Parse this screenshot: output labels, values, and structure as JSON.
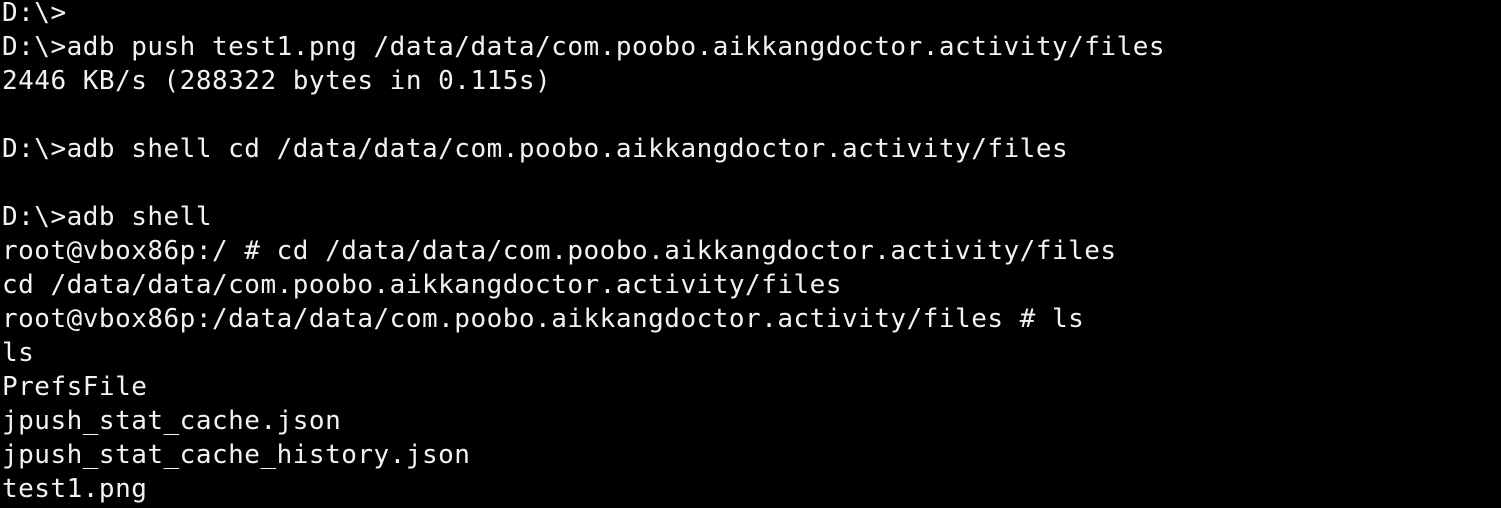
{
  "terminal": {
    "foreground": "#f2f2f2",
    "background": "#000000",
    "lines": [
      "D:\\>",
      "D:\\>adb push test1.png /data/data/com.poobo.aikkangdoctor.activity/files",
      "2446 KB/s (288322 bytes in 0.115s)",
      "",
      "D:\\>adb shell cd /data/data/com.poobo.aikkangdoctor.activity/files",
      "",
      "D:\\>adb shell",
      "root@vbox86p:/ # cd /data/data/com.poobo.aikkangdoctor.activity/files",
      "cd /data/data/com.poobo.aikkangdoctor.activity/files",
      "root@vbox86p:/data/data/com.poobo.aikkangdoctor.activity/files # ls",
      "ls",
      "PrefsFile",
      "jpush_stat_cache.json",
      "jpush_stat_cache_history.json",
      "test1.png"
    ]
  }
}
